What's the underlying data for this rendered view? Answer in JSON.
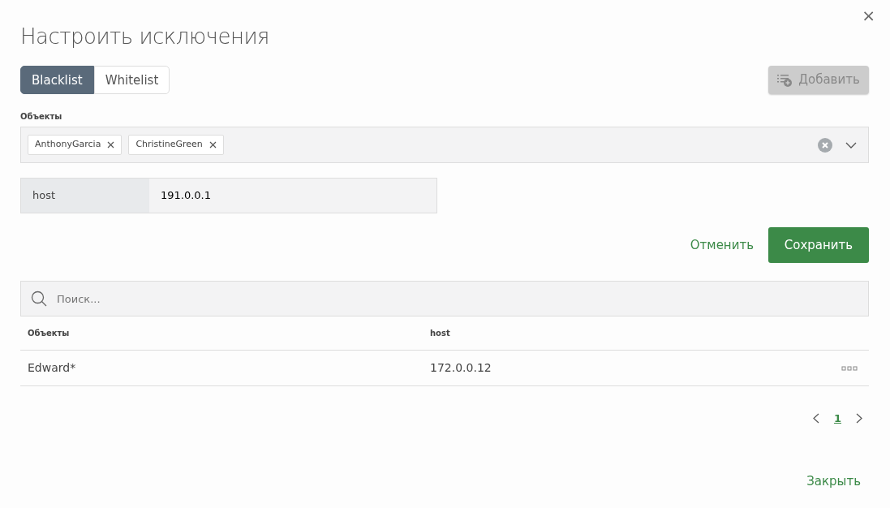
{
  "dialog": {
    "title": "Настроить исключения",
    "close_label": "×"
  },
  "tabs": [
    {
      "label": "Blacklist",
      "selected": true
    },
    {
      "label": "Whitelist",
      "selected": false
    }
  ],
  "add_button": {
    "label": "Добавить",
    "disabled": true
  },
  "objects_field": {
    "label": "Объекты",
    "tags": [
      "AnthonyGarcia",
      "ChristineGreen"
    ]
  },
  "host_field": {
    "label": "host",
    "value": "191.0.0.1"
  },
  "cancel_label": "Отменить",
  "save_label": "Сохранить",
  "search": {
    "placeholder": "Поиск..."
  },
  "table": {
    "columns": [
      "Объекты",
      "host"
    ],
    "rows": [
      [
        "Edward*",
        "172.0.0.12"
      ]
    ]
  },
  "pagination": {
    "pages": [
      {
        "label": "1",
        "selected": true
      }
    ]
  },
  "footer_button": "Закрыть"
}
